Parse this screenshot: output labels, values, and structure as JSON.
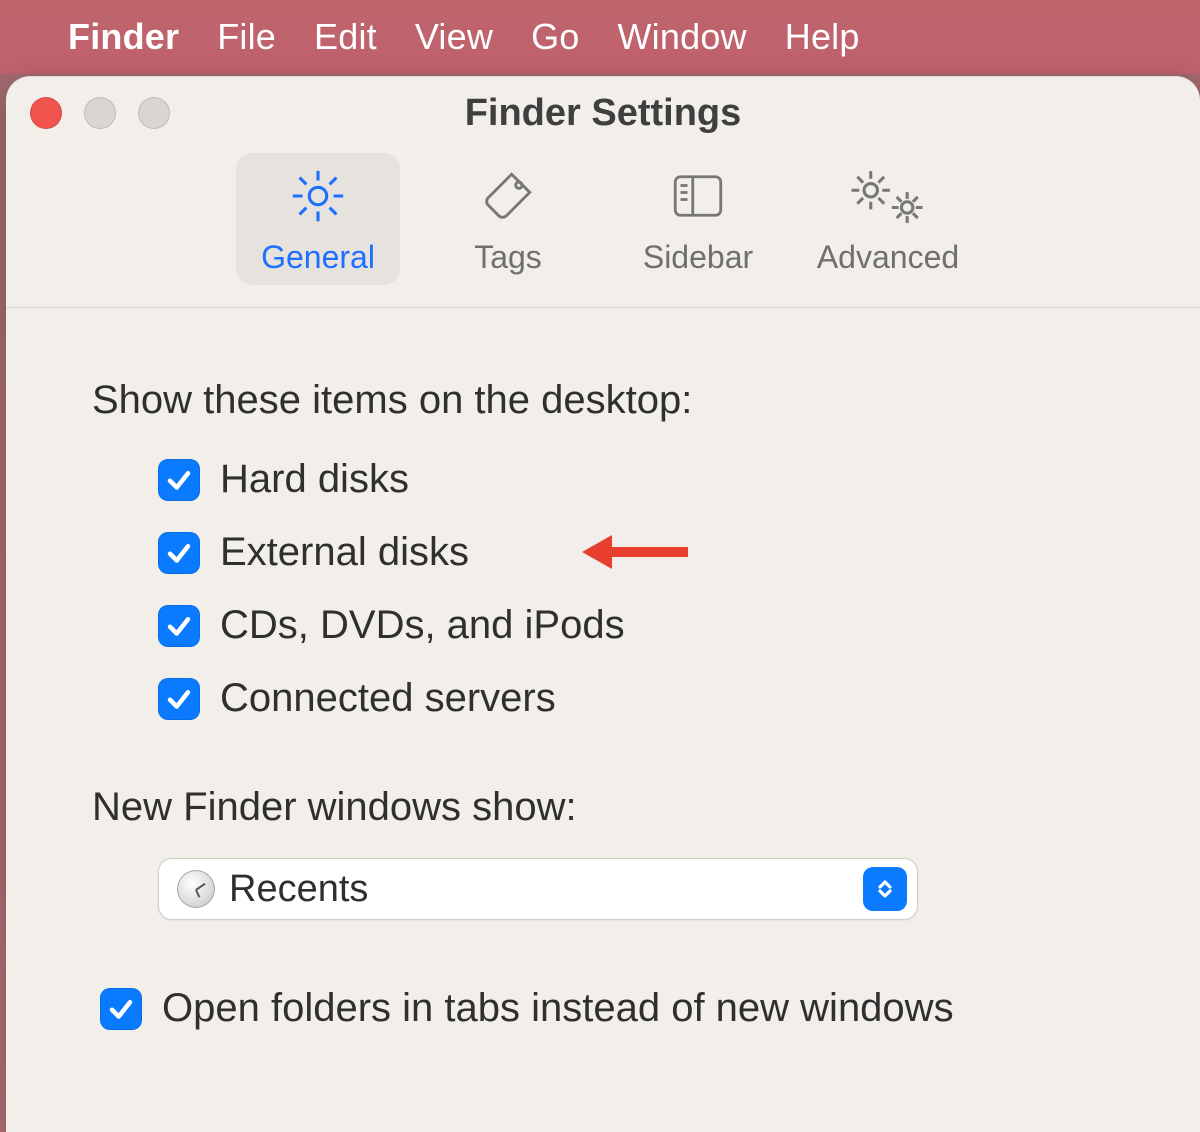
{
  "menubar": {
    "app": "Finder",
    "items": [
      "File",
      "Edit",
      "View",
      "Go",
      "Window",
      "Help"
    ]
  },
  "window": {
    "title": "Finder Settings"
  },
  "toolbar": {
    "tabs": [
      {
        "label": "General",
        "active": true
      },
      {
        "label": "Tags",
        "active": false
      },
      {
        "label": "Sidebar",
        "active": false
      },
      {
        "label": "Advanced",
        "active": false
      }
    ]
  },
  "desktop_section": {
    "title": "Show these items on the desktop:",
    "items": [
      {
        "label": "Hard disks",
        "checked": true
      },
      {
        "label": "External disks",
        "checked": true,
        "highlighted": true
      },
      {
        "label": "CDs, DVDs, and iPods",
        "checked": true
      },
      {
        "label": "Connected servers",
        "checked": true
      }
    ]
  },
  "new_window_section": {
    "title": "New Finder windows show:",
    "selected": "Recents"
  },
  "tabs_pref": {
    "label": "Open folders in tabs instead of new windows",
    "checked": true
  },
  "colors": {
    "accent": "#0a7aff",
    "arrow": "#e8402e"
  }
}
